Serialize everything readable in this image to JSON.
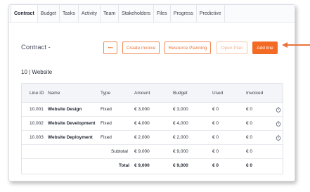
{
  "tabs": [
    "Contract",
    "Budget",
    "Tasks",
    "Activity",
    "Team",
    "Stakeholders",
    "Files",
    "Progress",
    "Predictive"
  ],
  "active_tab": "Contract",
  "title": "Contract -",
  "buttons": {
    "more": "•••",
    "create_invoice": "Create invoice",
    "resource_planning": "Resource Planning",
    "open_plan": "Open Plan",
    "add_line": "Add line"
  },
  "section": "10 | Website",
  "table": {
    "headers": [
      "Line ID",
      "Name",
      "Type",
      "Amount",
      "Budget",
      "Used",
      "Invoiced"
    ],
    "rows": [
      {
        "id": "10.001",
        "name": "Website Design",
        "type": "Fixed",
        "amount": "€ 3,000",
        "budget": "€ 3,000",
        "used": "€ 0",
        "invoiced": "€ 0"
      },
      {
        "id": "10.002",
        "name": "Website Development",
        "type": "Fixed",
        "amount": "€ 4,000",
        "budget": "€ 4,000",
        "used": "€ 0",
        "invoiced": "€ 0"
      },
      {
        "id": "10.003",
        "name": "Website Deployment",
        "type": "Fixed",
        "amount": "€ 2,000",
        "budget": "€ 2,000",
        "used": "€ 0",
        "invoiced": "€ 0"
      }
    ],
    "subtotal": {
      "label": "Subtotal",
      "amount": "€ 9,000",
      "budget": "€ 9,000",
      "used": "€ 0",
      "invoiced": "€ 0"
    },
    "total": {
      "label": "Total",
      "amount": "€ 9,000",
      "budget": "€ 9,000",
      "used": "€ 0",
      "invoiced": "€ 0"
    }
  },
  "colors": {
    "accent": "#f26a24",
    "arrow": "#e8743b"
  }
}
